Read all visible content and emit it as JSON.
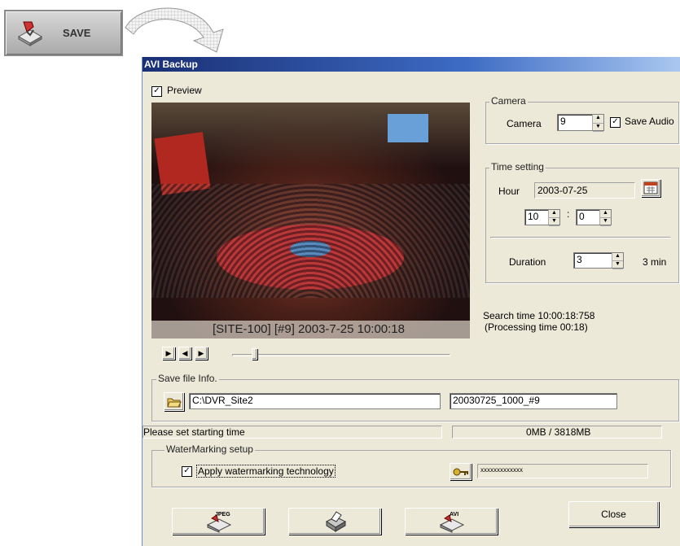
{
  "top_button": {
    "label": "SAVE"
  },
  "window": {
    "title": "AVI Backup"
  },
  "preview": {
    "checkbox_label": "Preview",
    "checked": true,
    "overlay": "[SITE-100] [#9] 2003-7-25 10:00:18"
  },
  "camera": {
    "group_title": "Camera",
    "label": "Camera",
    "value": "9",
    "save_audio_label": "Save Audio",
    "save_audio_checked": true
  },
  "time_setting": {
    "group_title": "Time setting",
    "hour_label": "Hour",
    "date": "2003-07-25",
    "hour": "10",
    "colon": ":",
    "minute": "0",
    "duration_label": "Duration",
    "duration": "3",
    "duration_unit": "3 min"
  },
  "search": {
    "search_time": "Search time 10:00:18:758",
    "processing_time": "(Processing time 00:18)"
  },
  "save_file": {
    "group_title": "Save file Info.",
    "path": "C:\\DVR_Site2",
    "filename": "20030725_1000_#9"
  },
  "status": {
    "message": "Please set starting time",
    "size": "0MB / 3818MB"
  },
  "watermark": {
    "group_title": "WaterMarking setup",
    "checkbox_label": "Apply watermarking technology",
    "checked": true,
    "password": "xxxxxxxxxxxxx"
  },
  "buttons": {
    "jpeg_label": "JPEG",
    "avi_label": "AVI",
    "close_label": "Close"
  }
}
